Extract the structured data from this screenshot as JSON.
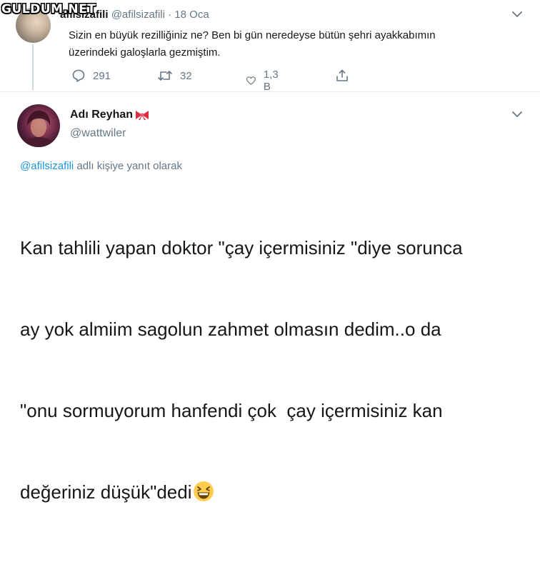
{
  "watermark": "GULDUM.NET",
  "tweet1": {
    "name": "afilsizafili",
    "handle": "@afilsizafili",
    "separator": "·",
    "date": "18 Oca",
    "text_lines": [
      "Sizin en büyük rezilliğiniz ne? Ben bi gün neredeyse bütün şehri ayakkabımın",
      "üzerindeki galoşlarla gezmiştim."
    ],
    "actions": {
      "replies": "291",
      "retweets": "32",
      "likes": "1,3 B"
    }
  },
  "tweet2": {
    "name": "Adı Reyhan",
    "handle": "@wattwiler",
    "reply_to_user": "@afilsizafili",
    "reply_to_suffix": " adlı kişiye yanıt olarak",
    "text_lines": [
      "Kan tahlili yapan doktor \"çay içermisiniz \"diye sorunca",
      "ay yok almiim sagolun zahmet olmasın dedim..o da",
      "\"onu sormuyorum hanfendi çok  çay içermisiniz kan",
      "değeriniz düşük\"dedi"
    ]
  },
  "colors": {
    "muted": "#657786",
    "link": "#1b95e0",
    "divider": "#e6ecf0",
    "text": "#14171a"
  },
  "icons": [
    "reply-icon",
    "retweet-icon",
    "like-icon",
    "share-icon",
    "chevron-down-icon",
    "bow-emoji-icon",
    "laughing-emoji-icon"
  ]
}
